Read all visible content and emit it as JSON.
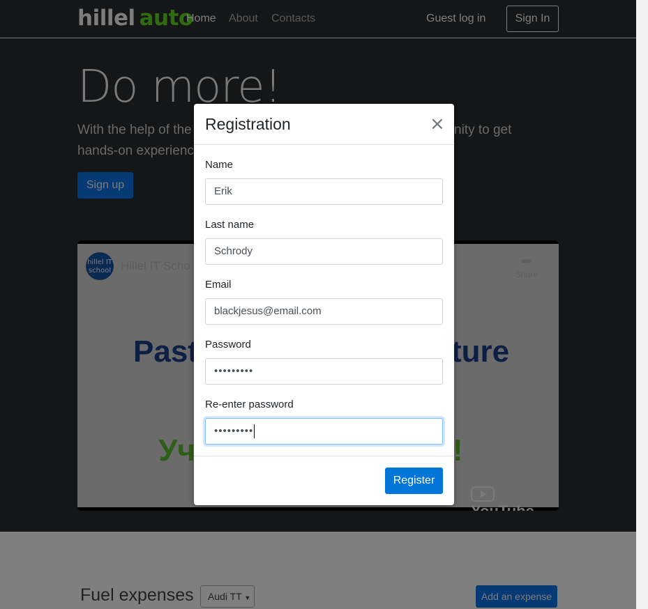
{
  "navbar": {
    "logo_part1": "hillel",
    "logo_part2": "auto",
    "links": [
      "Home",
      "About",
      "Contacts"
    ],
    "guest_login": "Guest log in",
    "sign_in": "Sign In"
  },
  "hero": {
    "title": "Do more!",
    "lead_line1_start": "With the help of the",
    "lead_line1_end": "nity to get",
    "lead_line2": "hands-on experienc",
    "signup_button": "Sign up"
  },
  "video": {
    "channel_logo_text": "hillel IT school",
    "title": "Hillel IT Scho",
    "share_label": "Share",
    "big_text_left": "Past",
    "big_text_right": "ture",
    "green_text_left": "Уч",
    "green_text_right": "!",
    "youtube_label": "YouTube"
  },
  "fuel": {
    "title": "Fuel expenses",
    "car_selected": "Audi TT",
    "add_expense_button": "Add an expense"
  },
  "modal": {
    "title": "Registration",
    "close_symbol": "×",
    "fields": {
      "name": {
        "label": "Name",
        "value": "Erik"
      },
      "last_name": {
        "label": "Last name",
        "value": "Schrody"
      },
      "email": {
        "label": "Email",
        "value": "blackjesus@email.com"
      },
      "password": {
        "label": "Password",
        "value": "•••••••••"
      },
      "repassword": {
        "label": "Re-enter password",
        "value": "•••••••••"
      }
    },
    "register_button": "Register"
  },
  "colors": {
    "primary": "#0275d8",
    "brand_green": "#4ca51c",
    "hero_bg": "#2b2d31"
  }
}
